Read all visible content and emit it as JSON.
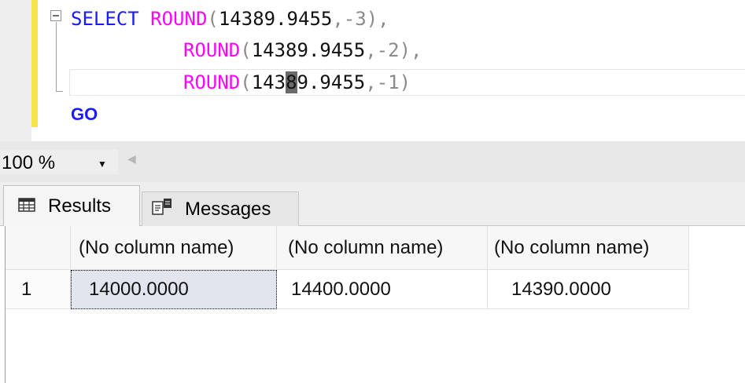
{
  "editor": {
    "lines": [
      {
        "keyword": "SELECT ",
        "func": "ROUND",
        "open": "(",
        "arg": "14389.9455",
        "comma": ",",
        "neg": "-3",
        "close": ")",
        "tail": ","
      },
      {
        "func": "ROUND",
        "open": "(",
        "arg": "14389.9455",
        "comma": ",",
        "neg": "-2",
        "close": ")",
        "tail": ","
      },
      {
        "func": "ROUND",
        "open": "(",
        "arg_a": "143",
        "arg_b": "8",
        "arg_c": "9.9455",
        "comma": ",",
        "neg": "-1",
        "close": ")"
      }
    ],
    "go": "GO"
  },
  "zoom": {
    "level": "100 %"
  },
  "tabs": {
    "results": "Results",
    "messages": "Messages"
  },
  "grid": {
    "columns": [
      "(No column name)",
      "(No column name)",
      "(No column name)"
    ],
    "rows": [
      {
        "num": "1",
        "values": [
          "14000.0000",
          "14400.0000",
          "14390.0000"
        ]
      }
    ]
  },
  "colors": {
    "keyword": "#1a1aff",
    "function": "#ff00ff",
    "punctuation": "#8a8a8a",
    "change_bar": "#f5e34a",
    "selected_cell": "#e1e6ee"
  },
  "icons": {
    "fold": "collapse-box-icon",
    "zoom": "dropdown-arrow-icon",
    "results_tab": "grid-table-icon",
    "messages_tab": "messages-icon"
  }
}
